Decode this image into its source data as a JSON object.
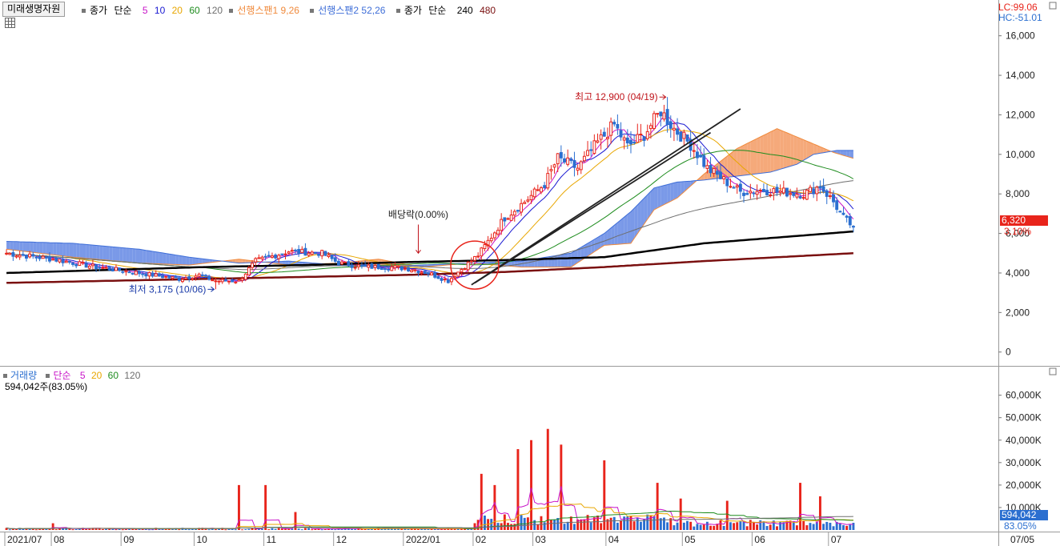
{
  "stock": {
    "name": "미래생명자원"
  },
  "legend": {
    "close_label": "종가",
    "simple_label": "단순",
    "ma_periods": [
      "5",
      "10",
      "20",
      "60",
      "120"
    ],
    "ma_colors": [
      "#c814c8",
      "#1a1ad2",
      "#e8a600",
      "#1e8c1e",
      "#6e6e6e"
    ],
    "span1_label": "선행스팬1 9,26",
    "span2_label": "선행스팬2 52,26",
    "long_close_label": "종가",
    "long_simple_label": "단순",
    "long_periods": [
      "240",
      "480"
    ],
    "long_colors": [
      "#000000",
      "#7a1010"
    ]
  },
  "indicators": {
    "lc": "LC:99.06",
    "hc": "HC:-51.01"
  },
  "current": {
    "price": "6,320",
    "change": "3.10%",
    "volume": "594,042",
    "volume_pct": "83.05%"
  },
  "annotations": {
    "high": "최고 12,900 (04/19)",
    "low": "최저 3,175 (10/06)",
    "dividend": "배당락(0.00%)"
  },
  "volume_legend": {
    "label": "거래량",
    "simple_label": "단순",
    "periods": [
      "5",
      "20",
      "60",
      "120"
    ],
    "sub": "594,042주(83.05%)"
  },
  "x_axis": {
    "labels": [
      "2021/07",
      "08",
      "09",
      "10",
      "11",
      "12",
      "2022/01",
      "02",
      "03",
      "04",
      "05",
      "06",
      "07"
    ],
    "right_label": "07/05"
  },
  "colors": {
    "up": "#e8241b",
    "down": "#2b6fd0",
    "cloud_bull": "#f4a06c",
    "cloud_bear": "#6b8ee6",
    "ma240": "#000000",
    "ma480": "#7a1010",
    "trend": "#222222",
    "circle": "#e8241b"
  },
  "chart_data": [
    {
      "type": "candlestick",
      "title": "미래생명자원",
      "ylim": [
        -700,
        17000
      ],
      "y_ticks": [
        0,
        2000,
        4000,
        6000,
        8000,
        10000,
        12000,
        14000,
        16000
      ],
      "y_tick_labels": [
        "0",
        "2,000",
        "4,000",
        "6,000",
        "8,000",
        "10,000",
        "12,000",
        "14,000",
        "16,000"
      ],
      "months": [
        "2021/07",
        "08",
        "09",
        "10",
        "11",
        "12",
        "2022/01",
        "02",
        "03",
        "04",
        "05",
        "06",
        "07"
      ],
      "close_anchors": [
        [
          0,
          5000
        ],
        [
          14,
          4700
        ],
        [
          27,
          4300
        ],
        [
          40,
          4000
        ],
        [
          52,
          3700
        ],
        [
          58,
          3900
        ],
        [
          63,
          3600
        ],
        [
          70,
          3600
        ],
        [
          75,
          4600
        ],
        [
          85,
          5100
        ],
        [
          95,
          5000
        ],
        [
          100,
          4500
        ],
        [
          108,
          4300
        ],
        [
          116,
          4300
        ],
        [
          122,
          4200
        ],
        [
          127,
          4000
        ],
        [
          133,
          3600
        ],
        [
          137,
          4200
        ],
        [
          142,
          4900
        ],
        [
          145,
          5600
        ],
        [
          150,
          6800
        ],
        [
          156,
          7600
        ],
        [
          162,
          8500
        ],
        [
          166,
          9800
        ],
        [
          172,
          9300
        ],
        [
          178,
          10600
        ],
        [
          183,
          11500
        ],
        [
          187,
          10400
        ],
        [
          192,
          11000
        ],
        [
          197,
          12200
        ],
        [
          201,
          11300
        ],
        [
          206,
          10500
        ],
        [
          211,
          9300
        ],
        [
          216,
          8700
        ],
        [
          221,
          8100
        ],
        [
          228,
          8200
        ],
        [
          234,
          8100
        ],
        [
          240,
          8000
        ],
        [
          245,
          8400
        ],
        [
          249,
          7600
        ],
        [
          252,
          6800
        ],
        [
          255,
          6320
        ]
      ],
      "high": {
        "value": 12900,
        "date": "04/19",
        "index": 199
      },
      "low": {
        "value": 3175,
        "date": "10/06",
        "index": 63
      },
      "ma240_anchors": [
        [
          0,
          4000
        ],
        [
          60,
          4300
        ],
        [
          90,
          4400
        ],
        [
          120,
          4550
        ],
        [
          150,
          4650
        ],
        [
          180,
          4800
        ],
        [
          210,
          5500
        ],
        [
          255,
          6100
        ]
      ],
      "ma480_anchors": [
        [
          0,
          3500
        ],
        [
          60,
          3700
        ],
        [
          120,
          3900
        ],
        [
          150,
          4050
        ],
        [
          180,
          4300
        ],
        [
          210,
          4600
        ],
        [
          255,
          5000
        ]
      ],
      "span1_anchors": [
        [
          0,
          5200
        ],
        [
          20,
          4800
        ],
        [
          40,
          4500
        ],
        [
          55,
          4400
        ],
        [
          70,
          4700
        ],
        [
          85,
          4400
        ],
        [
          100,
          4500
        ],
        [
          112,
          4700
        ],
        [
          125,
          4300
        ],
        [
          140,
          4500
        ],
        [
          155,
          4300
        ],
        [
          170,
          4300
        ],
        [
          180,
          5400
        ],
        [
          188,
          5500
        ],
        [
          195,
          7200
        ],
        [
          202,
          7800
        ],
        [
          210,
          9000
        ],
        [
          220,
          10300
        ],
        [
          232,
          11300
        ],
        [
          242,
          10600
        ],
        [
          249,
          10100
        ],
        [
          255,
          9800
        ]
      ],
      "span2_anchors": [
        [
          0,
          5600
        ],
        [
          20,
          5500
        ],
        [
          40,
          5200
        ],
        [
          55,
          4800
        ],
        [
          70,
          4500
        ],
        [
          85,
          4600
        ],
        [
          100,
          4400
        ],
        [
          112,
          4300
        ],
        [
          125,
          4400
        ],
        [
          140,
          4500
        ],
        [
          155,
          4600
        ],
        [
          170,
          5000
        ],
        [
          180,
          6000
        ],
        [
          188,
          7100
        ],
        [
          195,
          8300
        ],
        [
          202,
          8600
        ],
        [
          210,
          8700
        ],
        [
          220,
          8900
        ],
        [
          230,
          9100
        ],
        [
          238,
          9500
        ],
        [
          243,
          10000
        ],
        [
          250,
          10200
        ],
        [
          255,
          10200
        ]
      ],
      "trendlines": [
        {
          "name": "trend-line-1",
          "from": [
            140,
            3400
          ],
          "to": [
            221,
            12300
          ]
        },
        {
          "name": "trend-line-2",
          "from": [
            141,
            3500
          ],
          "to": [
            212,
            11100
          ]
        }
      ],
      "dividend_index": 124
    },
    {
      "type": "bar",
      "title": "거래량",
      "ylim": [
        0,
        67000
      ],
      "unit": "K",
      "y_ticks": [
        10000,
        20000,
        30000,
        40000,
        50000,
        60000
      ],
      "y_tick_labels": [
        "10,000K",
        "20,000K",
        "30,000K",
        "40,000K",
        "50,000K",
        "60,000K"
      ],
      "base_volume": 700,
      "spikes": [
        [
          14,
          3000
        ],
        [
          70,
          20000
        ],
        [
          78,
          20000
        ],
        [
          87,
          8000
        ],
        [
          143,
          25000
        ],
        [
          147,
          20000
        ],
        [
          154,
          36000
        ],
        [
          158,
          40000
        ],
        [
          163,
          45000
        ],
        [
          167,
          38000
        ],
        [
          180,
          31000
        ],
        [
          196,
          21000
        ],
        [
          203,
          14000
        ],
        [
          217,
          13000
        ],
        [
          239,
          21000
        ],
        [
          245,
          15000
        ]
      ]
    }
  ]
}
